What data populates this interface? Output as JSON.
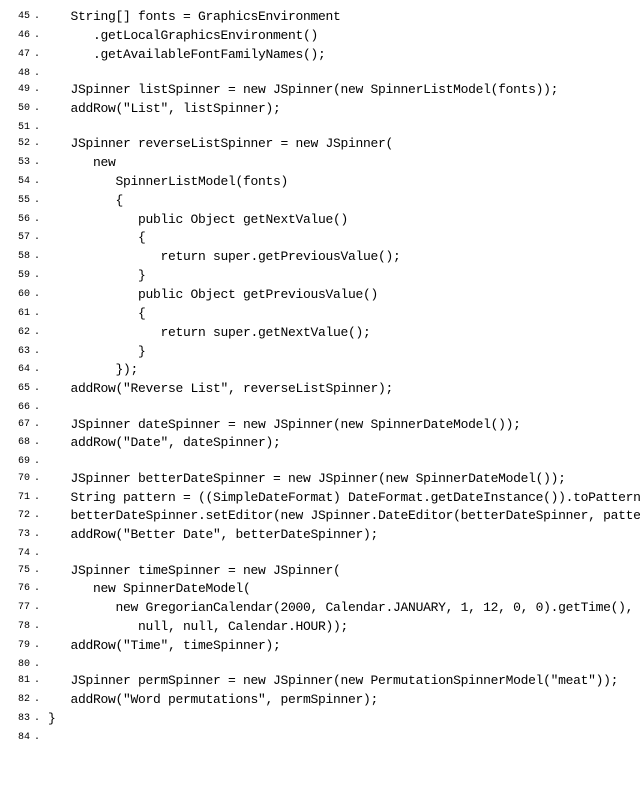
{
  "lines": [
    {
      "num": "45",
      "code": "   String[] fonts = GraphicsEnvironment"
    },
    {
      "num": "46",
      "code": "      .getLocalGraphicsEnvironment()"
    },
    {
      "num": "47",
      "code": "      .getAvailableFontFamilyNames();"
    },
    {
      "num": "48",
      "code": ""
    },
    {
      "num": "49",
      "code": "   JSpinner listSpinner = new JSpinner(new SpinnerListModel(fonts));"
    },
    {
      "num": "50",
      "code": "   addRow(\"List\", listSpinner);"
    },
    {
      "num": "51",
      "code": ""
    },
    {
      "num": "52",
      "code": "   JSpinner reverseListSpinner = new JSpinner("
    },
    {
      "num": "53",
      "code": "      new"
    },
    {
      "num": "54",
      "code": "         SpinnerListModel(fonts)"
    },
    {
      "num": "55",
      "code": "         {"
    },
    {
      "num": "56",
      "code": "            public Object getNextValue()"
    },
    {
      "num": "57",
      "code": "            {"
    },
    {
      "num": "58",
      "code": "               return super.getPreviousValue();"
    },
    {
      "num": "59",
      "code": "            }"
    },
    {
      "num": "60",
      "code": "            public Object getPreviousValue()"
    },
    {
      "num": "61",
      "code": "            {"
    },
    {
      "num": "62",
      "code": "               return super.getNextValue();"
    },
    {
      "num": "63",
      "code": "            }"
    },
    {
      "num": "64",
      "code": "         });"
    },
    {
      "num": "65",
      "code": "   addRow(\"Reverse List\", reverseListSpinner);"
    },
    {
      "num": "66",
      "code": ""
    },
    {
      "num": "67",
      "code": "   JSpinner dateSpinner = new JSpinner(new SpinnerDateModel());"
    },
    {
      "num": "68",
      "code": "   addRow(\"Date\", dateSpinner);"
    },
    {
      "num": "69",
      "code": ""
    },
    {
      "num": "70",
      "code": "   JSpinner betterDateSpinner = new JSpinner(new SpinnerDateModel());"
    },
    {
      "num": "71",
      "code": "   String pattern = ((SimpleDateFormat) DateFormat.getDateInstance()).toPattern();"
    },
    {
      "num": "72",
      "code": "   betterDateSpinner.setEditor(new JSpinner.DateEditor(betterDateSpinner, pattern));"
    },
    {
      "num": "73",
      "code": "   addRow(\"Better Date\", betterDateSpinner);"
    },
    {
      "num": "74",
      "code": ""
    },
    {
      "num": "75",
      "code": "   JSpinner timeSpinner = new JSpinner("
    },
    {
      "num": "76",
      "code": "      new SpinnerDateModel("
    },
    {
      "num": "77",
      "code": "         new GregorianCalendar(2000, Calendar.JANUARY, 1, 12, 0, 0).getTime(),"
    },
    {
      "num": "78",
      "code": "            null, null, Calendar.HOUR));"
    },
    {
      "num": "79",
      "code": "   addRow(\"Time\", timeSpinner);"
    },
    {
      "num": "80",
      "code": ""
    },
    {
      "num": "81",
      "code": "   JSpinner permSpinner = new JSpinner(new PermutationSpinnerModel(\"meat\"));"
    },
    {
      "num": "82",
      "code": "   addRow(\"Word permutations\", permSpinner);"
    },
    {
      "num": "83",
      "code": "}"
    },
    {
      "num": "84",
      "code": ""
    }
  ]
}
